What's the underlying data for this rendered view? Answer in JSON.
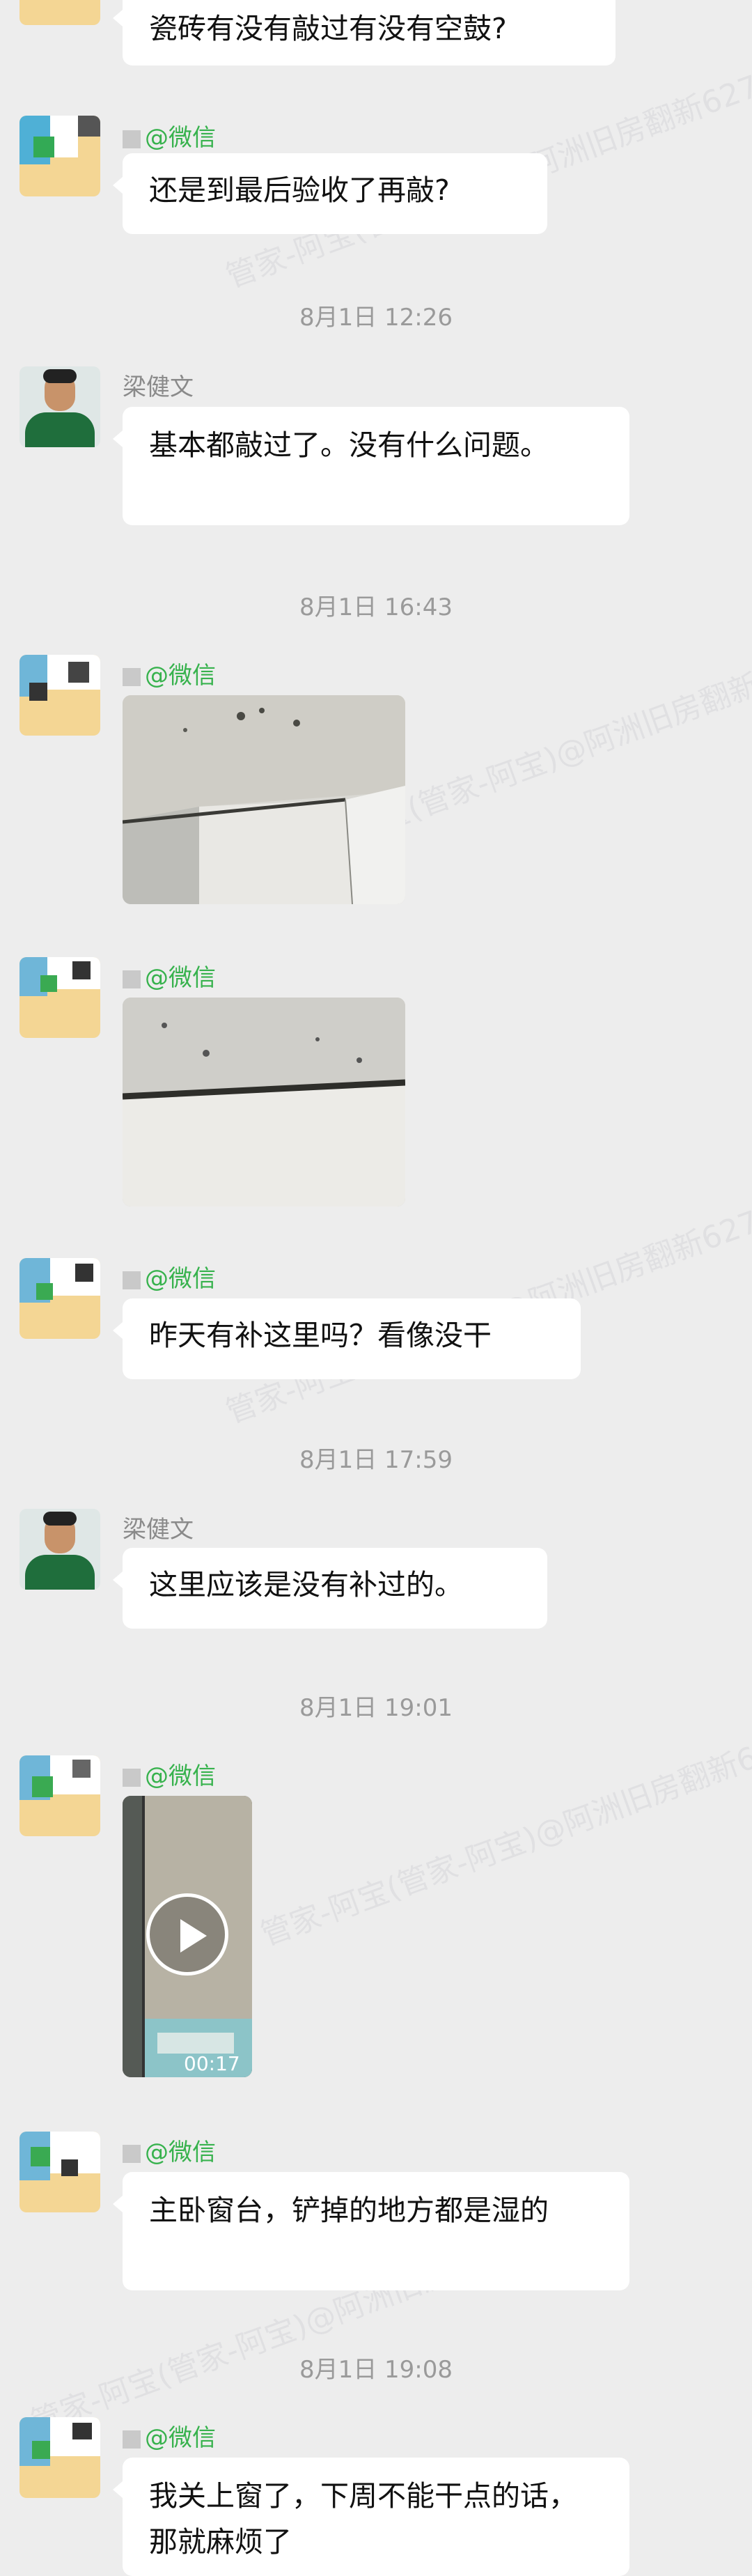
{
  "messages": [
    {
      "type": "text",
      "text": "瓷砖有没有敲过有没有空鼓?"
    },
    {
      "type": "text",
      "sender": "@微信",
      "text": "还是到最后验收了再敲?"
    },
    {
      "type": "time",
      "text": "8月1日  12:26"
    },
    {
      "type": "text",
      "sender": "梁健文",
      "text": "基本都敲过了。没有什么问题。"
    },
    {
      "type": "time",
      "text": "8月1日  16:43"
    },
    {
      "type": "image",
      "sender": "@微信"
    },
    {
      "type": "image",
      "sender": "@微信"
    },
    {
      "type": "text",
      "sender": "@微信",
      "text": "昨天有补这里吗？看像没干"
    },
    {
      "type": "time",
      "text": "8月1日  17:59"
    },
    {
      "type": "text",
      "sender": "梁健文",
      "text": "这里应该是没有补过的。"
    },
    {
      "type": "time",
      "text": "8月1日  19:01"
    },
    {
      "type": "video",
      "sender": "@微信",
      "duration": "00:17"
    },
    {
      "type": "text",
      "sender": "@微信",
      "text": "主卧窗台，铲掉的地方都是湿的"
    },
    {
      "type": "time",
      "text": "8月1日  19:08"
    },
    {
      "type": "text",
      "sender": "@微信",
      "text": "我关上窗了，下周不能干点的话，那就麻烦了"
    }
  ],
  "watermark": {
    "text": "管家-阿宝(管家-阿宝)@阿洲旧房翻新6279"
  },
  "colors": {
    "background": "#ededed",
    "bubble": "#ffffff",
    "wechat_green": "#37b24d"
  }
}
